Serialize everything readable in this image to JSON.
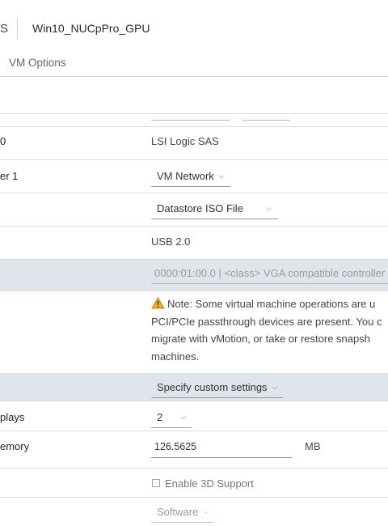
{
  "header": {
    "title_fragment": "S",
    "vm_name": "Win10_NUCpPro_GPU"
  },
  "tabs": {
    "vm_options": "VM Options"
  },
  "rows": {
    "scsi": {
      "label": "0",
      "value": "LSI Logic SAS"
    },
    "network": {
      "label": "er 1",
      "value": "VM Network"
    },
    "cd": {
      "value": "Datastore ISO File"
    },
    "usb": {
      "value": "USB 2.0"
    },
    "pci": {
      "value": "0000:01:00.0 | <class> VGA compatible controller"
    },
    "note": {
      "lines": [
        "Note: Some virtual machine operations are u",
        "PCI/PCIe passthrough devices are present. You c",
        "migrate with vMotion, or take or restore snapsh",
        "machines."
      ]
    },
    "video": {
      "value": "Specify custom settings"
    },
    "displays": {
      "label": "plays",
      "value": "2"
    },
    "memory": {
      "label": "emory",
      "value": "126.5625",
      "unit": "MB"
    },
    "enable3d": {
      "label": "Enable 3D Support"
    },
    "renderer": {
      "value": "Software"
    }
  },
  "icons": {
    "dropdown": "chevron-down-icon",
    "warning": "warning-icon",
    "checkbox": "checkbox-icon"
  },
  "colors": {
    "shaded_row": "#dfe5ea",
    "warning": "#f0b429"
  }
}
